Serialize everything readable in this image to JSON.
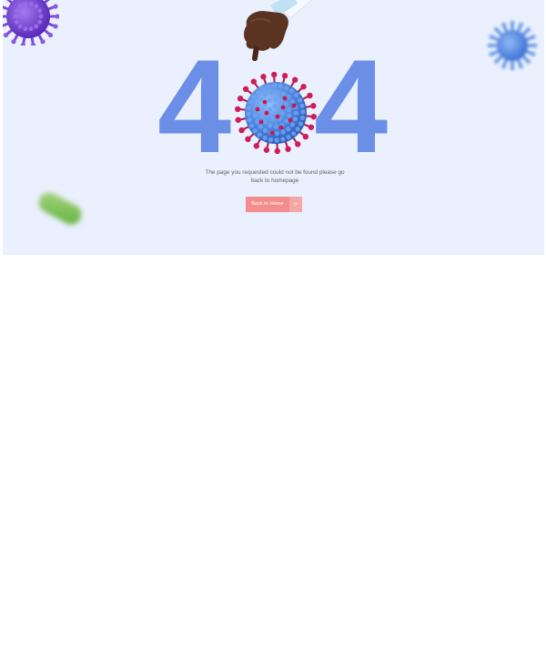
{
  "error": {
    "digit_left": "4",
    "digit_right": "4",
    "message": "The page you requested could not be found please go back to homepage"
  },
  "actions": {
    "back_home_label": "Back to Home",
    "back_home_icon": "+"
  },
  "colors": {
    "hero_background": "#eaf0fe",
    "digit": "#6b8fe6",
    "button": "#f38d8d",
    "button_icon": "#f7a6a6",
    "virus_body": "#4f86e0",
    "virus_spikes": "#c8174f",
    "virus_purple": "#7d4bd9"
  },
  "icons": {
    "decor_top_left": "purple-virus-icon",
    "decor_top_right": "blue-virus-icon",
    "decor_left": "green-pill-icon",
    "hand": "gloved-hand-icon",
    "zero": "coronavirus-icon",
    "button": "plus-icon"
  }
}
